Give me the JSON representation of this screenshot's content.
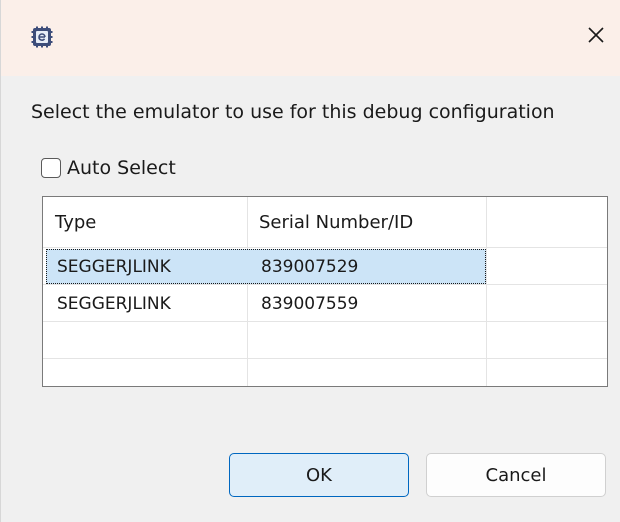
{
  "titlebar": {
    "app_icon": "eclipse-e2-icon",
    "close_icon": "close-icon",
    "close_glyph": "✕"
  },
  "prompt": "Select the emulator to use for this debug configuration",
  "auto_select": {
    "label": "Auto Select",
    "checked": false
  },
  "table": {
    "columns": [
      "Type",
      "Serial Number/ID",
      ""
    ],
    "rows": [
      {
        "type": "SEGGERJLINK",
        "serial": "839007529",
        "selected": true
      },
      {
        "type": "SEGGERJLINK",
        "serial": "839007559",
        "selected": false
      }
    ]
  },
  "buttons": {
    "ok": "OK",
    "cancel": "Cancel"
  },
  "colors": {
    "titlebar_bg": "#fbefe9",
    "selection": "#cce4f7",
    "accent": "#0067c0"
  }
}
